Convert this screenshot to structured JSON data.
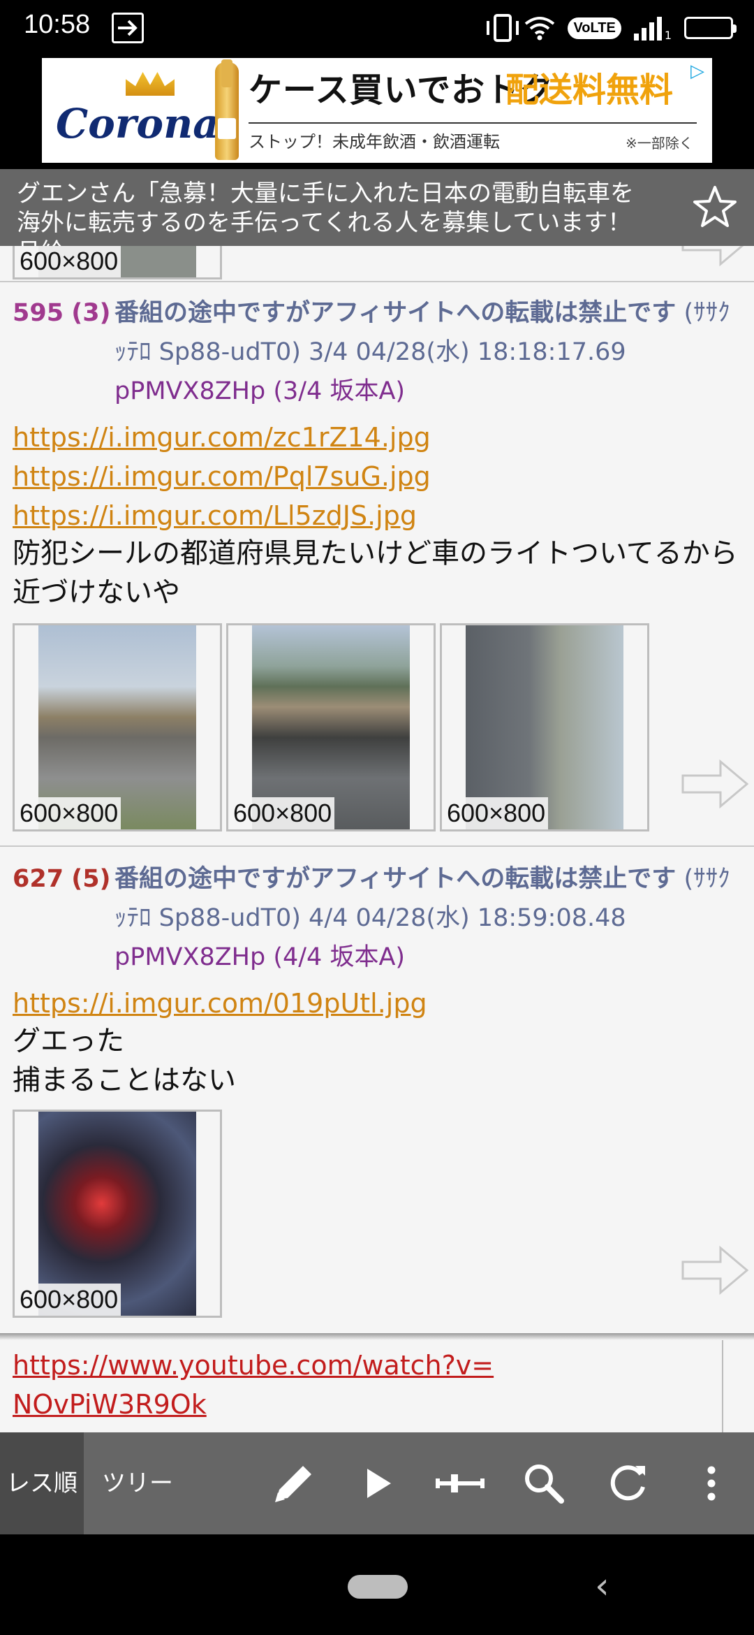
{
  "status_bar": {
    "time": "10:58",
    "network": "VoLTE",
    "sim_slot": "1"
  },
  "ad": {
    "brand": "Corona",
    "headline": "ケース買いでおトク",
    "highlight": "配送料無料",
    "subtext": "ストップ！未成年飲酒・飲酒運転",
    "note": "※一部除く"
  },
  "header": {
    "title": "グエンさん「急募！大量に手に入れた日本の電動自転車を海外に転売するのを手伝ってくれる人を募集しています！月給"
  },
  "top_partial": {
    "thumb_size": "600×800"
  },
  "posts": [
    {
      "number": "595",
      "count": "(3)",
      "title": "番組の途中ですがアフィサイトへの転載は禁止です",
      "meta": " (ｻｻｸｯﾃﾛ Sp88-udT0) 3/4  04/28(水) 18:18:17.69",
      "id": "pPMVX8ZHp (3/4 坂本A)",
      "links": [
        "https://i.imgur.com/zc1rZ14.jpg",
        "https://i.imgur.com/Pql7suG.jpg",
        "https://i.imgur.com/Ll5zdJS.jpg"
      ],
      "body": "防犯シールの都道府県見たいけど車のライトついてるから近づけないや",
      "thumb_sizes": [
        "600×800",
        "600×800",
        "600×800"
      ]
    },
    {
      "number": "627",
      "count": "(5)",
      "title": "番組の途中ですがアフィサイトへの転載は禁止です",
      "meta": " (ｻｻｸｯﾃﾛ Sp88-udT0) 4/4  04/28(水) 18:59:08.48",
      "id": "pPMVX8ZHp (4/4 坂本A)",
      "links": [
        "https://i.imgur.com/019pUtl.jpg"
      ],
      "body_lines": [
        "グエった",
        "捕まることはない"
      ],
      "thumb_sizes": [
        "600×800"
      ]
    }
  ],
  "embedded": {
    "link_line1": "https://www.youtube.com/watch?v=",
    "link_line2": "NOvPiW3R9Ok"
  },
  "toolbar": {
    "tab_order": "レス順",
    "tab_tree": "ツリー"
  },
  "colors": {
    "post_595_number": "#a0398e",
    "post_627_number": "#b0312a",
    "title": "#5d6a93",
    "id": "#7f2d8e",
    "link": "#d08412",
    "youtube_link": "#c21c1c"
  }
}
